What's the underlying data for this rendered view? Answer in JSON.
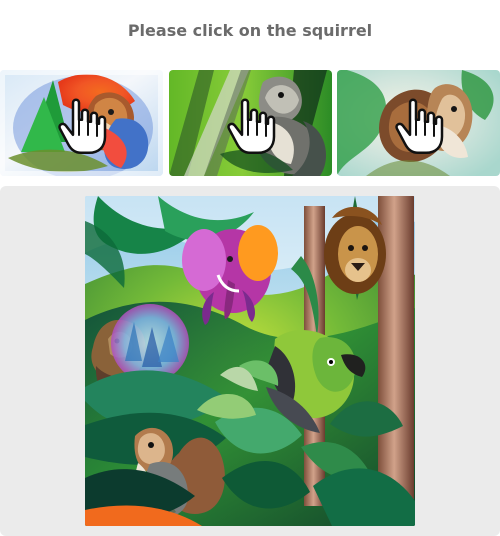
{
  "captcha": {
    "prompt": "Please click on the squirrel",
    "examples": [
      {
        "subject": "squirrel",
        "style": "colorful painted squirrel with pointing hand overlay"
      },
      {
        "subject": "squirrel",
        "style": "gray squirrel on green background with pointing hand overlay"
      },
      {
        "subject": "squirrel",
        "style": "watercolor squirrel with pointing hand overlay"
      }
    ],
    "challenge": {
      "scene": "jungle watercolor scene containing elephant, lion, bear, parrot and squirrel"
    }
  },
  "icons": {
    "hand": "pointing-hand-icon"
  },
  "colors": {
    "prompt_text": "#6b6b6b",
    "panel_background": "#ebebeb",
    "jungle_dark": "#164d3a",
    "jungle_light": "#7bbf45",
    "sky": "#b8dcf2"
  }
}
